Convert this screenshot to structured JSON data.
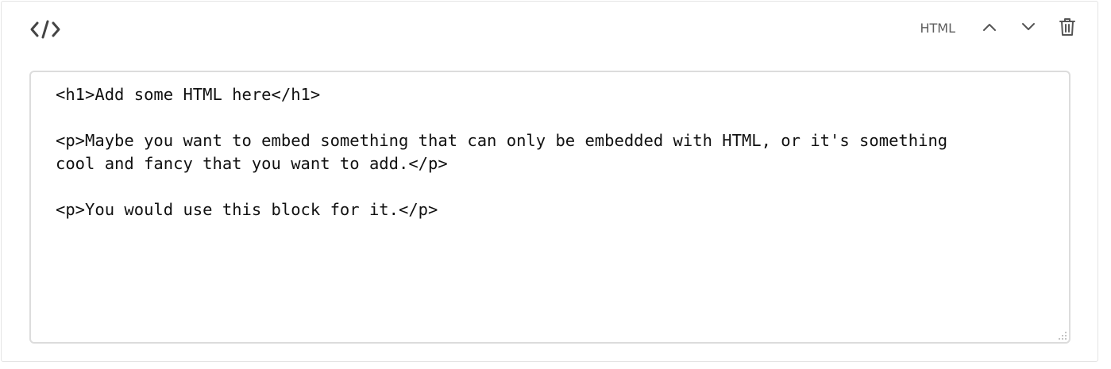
{
  "block": {
    "icon": "code-icon",
    "type_label": "HTML",
    "toolbar_icons": [
      "chevron-up-icon",
      "chevron-down-icon",
      "trash-icon"
    ]
  },
  "editor": {
    "content": "<h1>Add some HTML here</h1>\n\n<p>Maybe you want to embed something that can only be embedded with HTML, or it's something\ncool and fancy that you want to add.</p>\n\n<p>You would use this block for it.</p>"
  },
  "colors": {
    "icon": "#444444",
    "border": "#dcdcdc",
    "text": "#111111"
  }
}
